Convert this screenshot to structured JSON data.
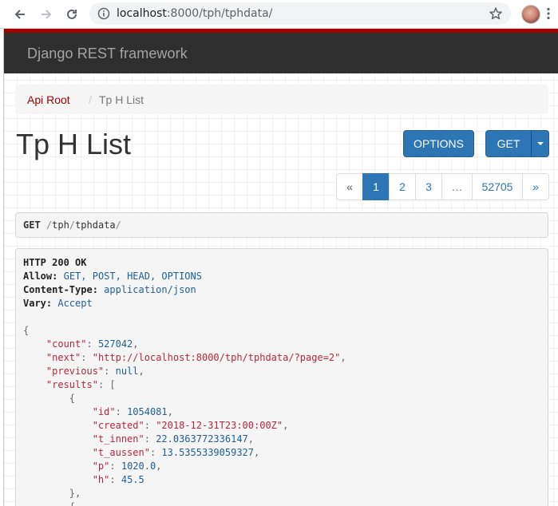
{
  "browser": {
    "url_host": "localhost",
    "url_rest": ":8000/tph/tphdata/"
  },
  "navbar": {
    "brand": "Django REST framework"
  },
  "breadcrumb": {
    "root": "Api Root",
    "separator": "/",
    "current": "Tp H List"
  },
  "page": {
    "title": "Tp H List"
  },
  "buttons": {
    "options": "OPTIONS",
    "get": "GET"
  },
  "pagination": {
    "prev": "«",
    "pages": [
      "1",
      "2",
      "3"
    ],
    "ellipsis": "…",
    "last": "52705",
    "next": "»",
    "active": "1"
  },
  "request": {
    "method": "GET",
    "path_parts": [
      "tph",
      "tphdata"
    ]
  },
  "response": {
    "status": "HTTP 200 OK",
    "headers": [
      {
        "key": "Allow:",
        "value": "GET, POST, HEAD, OPTIONS"
      },
      {
        "key": "Content-Type:",
        "value": "application/json"
      },
      {
        "key": "Vary:",
        "value": "Accept"
      }
    ],
    "json": {
      "count_key": "\"count\"",
      "count": "527042",
      "next_key": "\"next\"",
      "next": "\"http://localhost:8000/tph/tphdata/?page=2\"",
      "previous_key": "\"previous\"",
      "previous": "null",
      "results_key": "\"results\"",
      "item": {
        "id_key": "\"id\"",
        "id": "1054081",
        "created_key": "\"created\"",
        "created": "\"2018-12-31T23:00:00Z\"",
        "t_innen_key": "\"t_innen\"",
        "t_innen": "22.0363772336147",
        "t_aussen_key": "\"t_aussen\"",
        "t_aussen": "13.5355339059327",
        "p_key": "\"p\"",
        "p": "1020.0",
        "h_key": "\"h\"",
        "h": "45.5"
      }
    }
  },
  "colors": {
    "accent": "#2c76b5",
    "brand_red": "#a30000",
    "navbar_bg": "#2f2f2f"
  }
}
